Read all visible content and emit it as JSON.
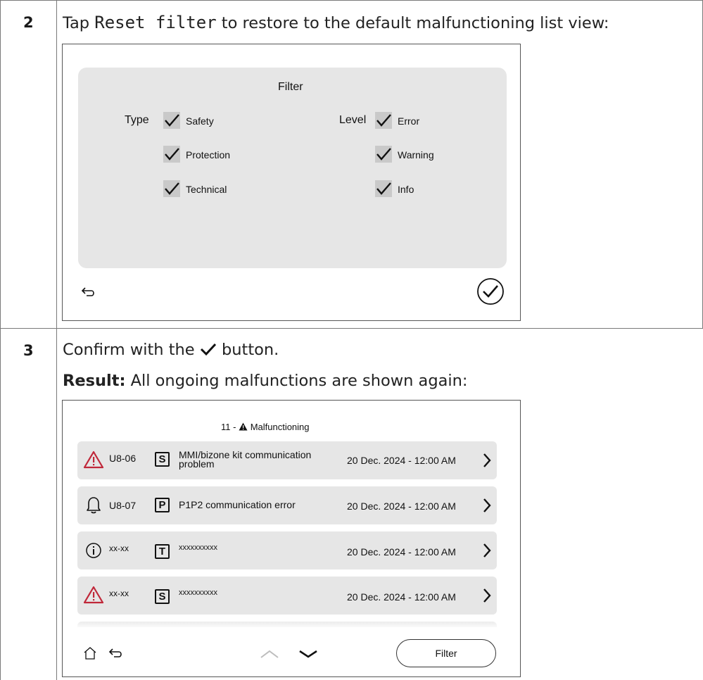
{
  "step2": {
    "number": "2",
    "text_before": "Tap ",
    "code": "Reset filter",
    "text_after": " to restore to the default malfunctioning list view:"
  },
  "filter_screen": {
    "title": "Filter",
    "type_label": "Type",
    "level_label": "Level",
    "type_options": [
      {
        "label": "Safety",
        "checked": true
      },
      {
        "label": "Protection",
        "checked": true
      },
      {
        "label": "Technical",
        "checked": true
      }
    ],
    "level_options": [
      {
        "label": "Error",
        "checked": true
      },
      {
        "label": "Warning",
        "checked": true
      },
      {
        "label": "Info",
        "checked": true
      }
    ],
    "back_icon": "back-arrow-icon",
    "confirm_icon": "check-circle-icon"
  },
  "step3": {
    "number": "3",
    "text_before": "Confirm with the ",
    "text_after": " button.",
    "result_label": "Result:",
    "result_text": " All ongoing malfunctions are shown again:"
  },
  "malfunction_screen": {
    "title_count": "11",
    "title_sep": " - ",
    "title_text": "Malfunctioning",
    "rows": [
      {
        "icon": "warning-triangle-icon",
        "code": "U8-06",
        "type": "S",
        "desc_line1": "MMI/bizone kit communication",
        "desc_line2": "problem",
        "date": "20 Dec. 2024 - 12:00 AM"
      },
      {
        "icon": "bell-icon",
        "code": "U8-07",
        "type": "P",
        "desc_line1": "P1P2 communication error",
        "desc_line2": "",
        "date": "20 Dec. 2024 - 12:00 AM"
      },
      {
        "icon": "info-circle-icon",
        "code": "xx-xx",
        "type": "T",
        "desc_line1": "xxxxxxxxxx",
        "desc_line2": "",
        "date": "20 Dec. 2024 - 12:00 AM"
      },
      {
        "icon": "warning-triangle-icon",
        "code": "xx-xx",
        "type": "S",
        "desc_line1": "xxxxxxxxxx",
        "desc_line2": "",
        "date": "20 Dec. 2024 - 12:00 AM"
      }
    ],
    "filter_button": "Filter",
    "warning_color": "#c0283a"
  }
}
